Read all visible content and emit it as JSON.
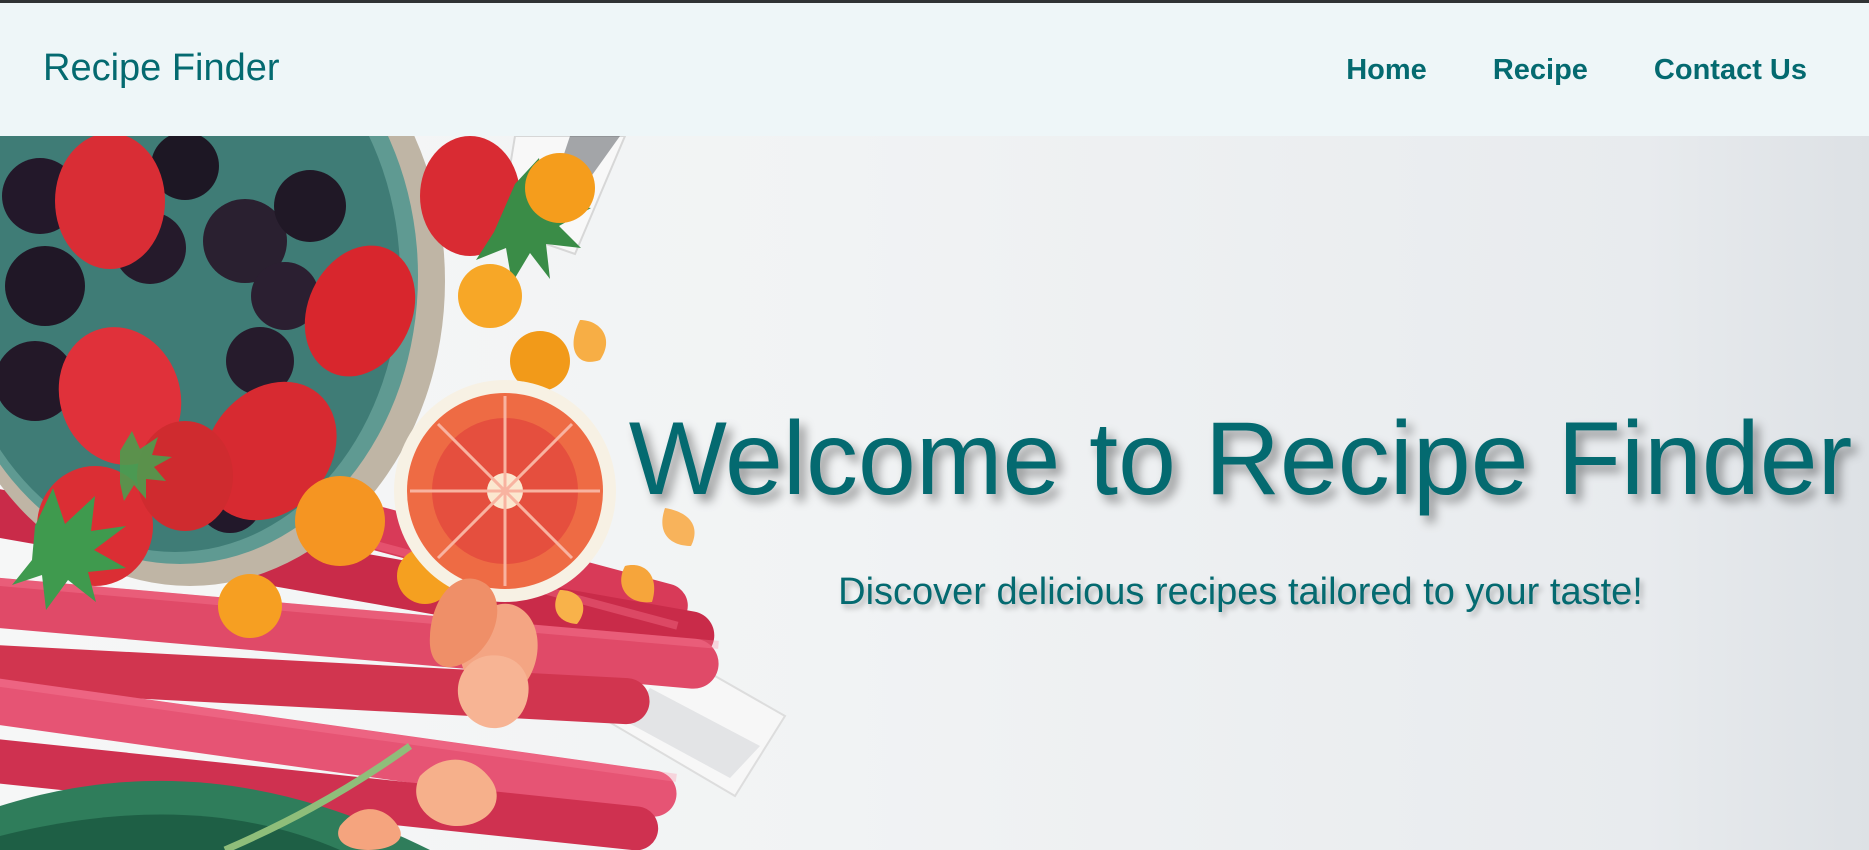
{
  "header": {
    "logo": "Recipe Finder",
    "nav": [
      "Home",
      "Recipe",
      "Contact Us"
    ]
  },
  "hero": {
    "title": "Welcome to Recipe Finder",
    "subtitle": "Discover delicious recipes tailored to your taste!",
    "image_subject": "fruit-bowl-strawberries-blackberries-citrus-rhubarb"
  },
  "colors": {
    "brand": "#046a70",
    "header_bg": "#eef6f8",
    "hero_bg": "#f1f3f4"
  }
}
